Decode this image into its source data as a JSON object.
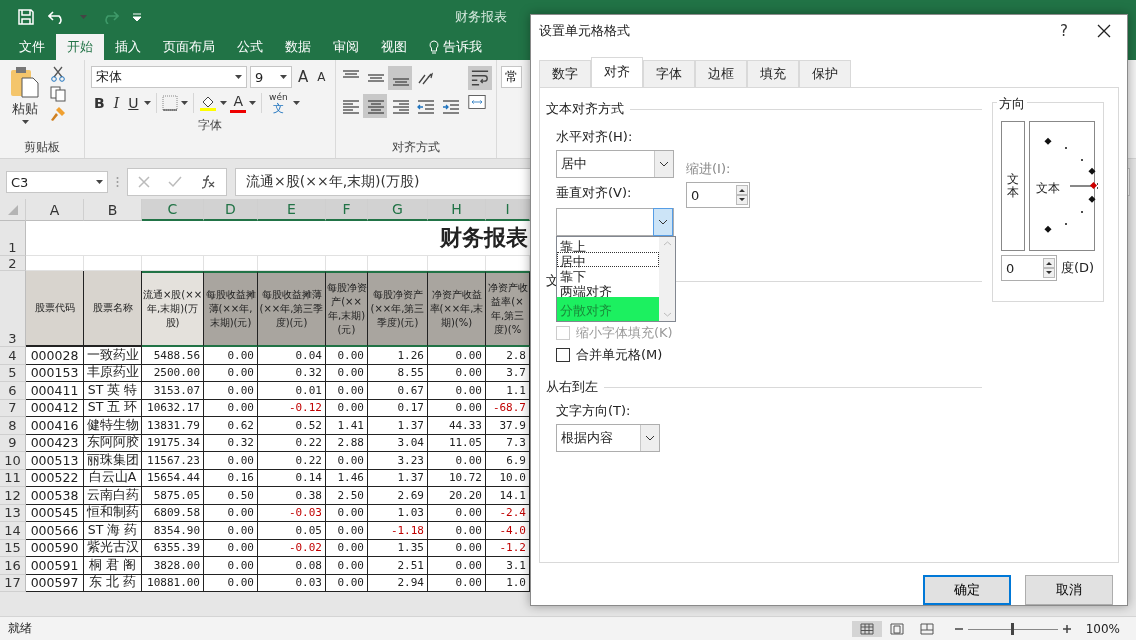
{
  "title_bar": {
    "title": "财务报表"
  },
  "ribbon_tabs": [
    {
      "label": "文件",
      "selected": false,
      "kind": "tab"
    },
    {
      "label": "开始",
      "selected": true,
      "kind": "tab"
    },
    {
      "label": "插入",
      "selected": false,
      "kind": "tab"
    },
    {
      "label": "页面布局",
      "selected": false,
      "kind": "tab"
    },
    {
      "label": "公式",
      "selected": false,
      "kind": "tab"
    },
    {
      "label": "数据",
      "selected": false,
      "kind": "tab"
    },
    {
      "label": "审阅",
      "selected": false,
      "kind": "tab"
    },
    {
      "label": "视图",
      "selected": false,
      "kind": "tab"
    },
    {
      "label": "告诉我",
      "selected": false,
      "kind": "tell"
    }
  ],
  "ribbon": {
    "clipboard": {
      "label": "剪贴板",
      "paste": "粘贴"
    },
    "font": {
      "label": "字体",
      "font_name": "宋体",
      "font_size": "9",
      "grow": "A",
      "shrink": "A",
      "bold": "B",
      "italic": "I",
      "underline": "U",
      "font_color": "A",
      "phonetic": "wén",
      "phonetic_char": "文"
    },
    "alignment": {
      "label": "对齐方式",
      "rows": [
        [
          {
            "kind": "top",
            "selected": false
          },
          {
            "kind": "middle",
            "selected": false
          },
          {
            "kind": "bottom",
            "selected": true
          },
          {
            "kind": "orient",
            "selected": false
          }
        ],
        [
          {
            "kind": "left",
            "selected": false
          },
          {
            "kind": "center",
            "selected": true
          },
          {
            "kind": "right",
            "selected": false
          },
          {
            "kind": "outdent",
            "selected": false
          },
          {
            "kind": "indent",
            "selected": false
          }
        ]
      ],
      "wrap_selected": true
    },
    "number": {
      "format": "常"
    }
  },
  "formula_bar": {
    "name_box": "C3",
    "formula": "流通×股(××年,末期)(万股)"
  },
  "sheet": {
    "columns": [
      {
        "label": "A",
        "selected": false
      },
      {
        "label": "B",
        "selected": false
      },
      {
        "label": "C",
        "selected": true
      },
      {
        "label": "D",
        "selected": true
      },
      {
        "label": "E",
        "selected": true
      },
      {
        "label": "F",
        "selected": true
      },
      {
        "label": "G",
        "selected": true
      },
      {
        "label": "H",
        "selected": true
      },
      {
        "label": "I",
        "selected": true
      }
    ],
    "title_row": "1",
    "blank_row": "2",
    "header_row_num": "3",
    "title": "财务报表",
    "header_row": [
      {
        "text": "股票代码",
        "selected": false,
        "active": false
      },
      {
        "text": "股票名称",
        "selected": false,
        "active": false
      },
      {
        "text": "流通×股(××年,末期)(万股)",
        "selected": true,
        "active": true
      },
      {
        "text": "每股收益摊薄(××年,末期)(元)",
        "selected": true,
        "active": false
      },
      {
        "text": "每股收益摊薄(××年,第三季度)(元)",
        "selected": true,
        "active": false
      },
      {
        "text": "每股净资产(××年,末期)(元)",
        "selected": true,
        "active": false
      },
      {
        "text": "每股净资产(××年,第三季度)(元)",
        "selected": true,
        "active": false
      },
      {
        "text": "净资产收益率(××年,末期)(%)",
        "selected": true,
        "active": false
      },
      {
        "text": "净资产收益率(×年,第三度)(%",
        "selected": true,
        "active": false
      }
    ],
    "rows": [
      {
        "num": "4",
        "cells": [
          "000028",
          "一致药业",
          "5488.56",
          "0.00",
          "0.04",
          "0.00",
          "1.26",
          "0.00",
          "2.8"
        ],
        "negative": [
          false,
          false,
          false,
          false,
          false,
          false,
          false,
          false,
          false
        ]
      },
      {
        "num": "5",
        "cells": [
          "000153",
          "丰原药业",
          "2500.00",
          "0.00",
          "0.32",
          "0.00",
          "8.55",
          "0.00",
          "3.7"
        ],
        "negative": [
          false,
          false,
          false,
          false,
          false,
          false,
          false,
          false,
          false
        ]
      },
      {
        "num": "6",
        "cells": [
          "000411",
          "ST 英 特",
          "3153.07",
          "0.00",
          "0.01",
          "0.00",
          "0.67",
          "0.00",
          "1.1"
        ],
        "negative": [
          false,
          false,
          false,
          false,
          false,
          false,
          false,
          false,
          false
        ]
      },
      {
        "num": "7",
        "cells": [
          "000412",
          "ST 五 环",
          "10632.17",
          "0.00",
          "-0.12",
          "0.00",
          "0.17",
          "0.00",
          "-68.7"
        ],
        "negative": [
          false,
          false,
          false,
          false,
          true,
          false,
          false,
          false,
          true
        ]
      },
      {
        "num": "8",
        "cells": [
          "000416",
          "健特生物",
          "13831.79",
          "0.62",
          "0.52",
          "1.41",
          "1.37",
          "44.33",
          "37.9"
        ],
        "negative": [
          false,
          false,
          false,
          false,
          false,
          false,
          false,
          false,
          false
        ]
      },
      {
        "num": "9",
        "cells": [
          "000423",
          "东阿阿胶",
          "19175.34",
          "0.32",
          "0.22",
          "2.88",
          "3.04",
          "11.05",
          "7.3"
        ],
        "negative": [
          false,
          false,
          false,
          false,
          false,
          false,
          false,
          false,
          false
        ]
      },
      {
        "num": "10",
        "cells": [
          "000513",
          "丽珠集团",
          "11567.23",
          "0.00",
          "0.22",
          "0.00",
          "3.23",
          "0.00",
          "6.9"
        ],
        "negative": [
          false,
          false,
          false,
          false,
          false,
          false,
          false,
          false,
          false
        ]
      },
      {
        "num": "11",
        "cells": [
          "000522",
          "白云山A",
          "15654.44",
          "0.16",
          "0.14",
          "1.46",
          "1.37",
          "10.72",
          "10.0"
        ],
        "negative": [
          false,
          false,
          false,
          false,
          false,
          false,
          false,
          false,
          false
        ]
      },
      {
        "num": "12",
        "cells": [
          "000538",
          "云南白药",
          "5875.05",
          "0.50",
          "0.38",
          "2.50",
          "2.69",
          "20.20",
          "14.1"
        ],
        "negative": [
          false,
          false,
          false,
          false,
          false,
          false,
          false,
          false,
          false
        ]
      },
      {
        "num": "13",
        "cells": [
          "000545",
          "恒和制药",
          "6809.58",
          "0.00",
          "-0.03",
          "0.00",
          "1.03",
          "0.00",
          "-2.4"
        ],
        "negative": [
          false,
          false,
          false,
          false,
          true,
          false,
          false,
          false,
          true
        ]
      },
      {
        "num": "14",
        "cells": [
          "000566",
          "ST 海 药",
          "8354.90",
          "0.00",
          "0.05",
          "0.00",
          "-1.18",
          "0.00",
          "-4.0"
        ],
        "negative": [
          false,
          false,
          false,
          false,
          false,
          false,
          true,
          false,
          true
        ]
      },
      {
        "num": "15",
        "cells": [
          "000590",
          "紫光古汉",
          "6355.39",
          "0.00",
          "-0.02",
          "0.00",
          "1.35",
          "0.00",
          "-1.2"
        ],
        "negative": [
          false,
          false,
          false,
          false,
          true,
          false,
          false,
          false,
          true
        ]
      },
      {
        "num": "16",
        "cells": [
          "000591",
          "桐 君 阁",
          "3828.00",
          "0.00",
          "0.08",
          "0.00",
          "2.51",
          "0.00",
          "3.1"
        ],
        "negative": [
          false,
          false,
          false,
          false,
          false,
          false,
          false,
          false,
          false
        ]
      },
      {
        "num": "17",
        "cells": [
          "000597",
          "东 北 药",
          "10881.00",
          "0.00",
          "0.03",
          "0.00",
          "2.94",
          "0.00",
          "1.0"
        ],
        "negative": [
          false,
          false,
          false,
          false,
          false,
          false,
          false,
          false,
          false
        ]
      }
    ]
  },
  "status_bar": {
    "status": "就绪",
    "zoom": "100%",
    "zoom_slider": {
      "level": 0.5
    },
    "views": [
      {
        "kind": "normal",
        "selected": true
      },
      {
        "kind": "page",
        "selected": false
      },
      {
        "kind": "break",
        "selected": false
      }
    ]
  },
  "dialog": {
    "title": "设置单元格格式",
    "help": "?",
    "tabs": [
      {
        "label": "数字",
        "selected": false
      },
      {
        "label": "对齐",
        "selected": true
      },
      {
        "label": "字体",
        "selected": false
      },
      {
        "label": "边框",
        "selected": false
      },
      {
        "label": "填充",
        "selected": false
      },
      {
        "label": "保护",
        "selected": false
      }
    ],
    "text_alignment": {
      "legend": "文本对齐方式",
      "horizontal_label": "水平对齐(H):",
      "horizontal_value": "居中",
      "indent_label": "缩进(I):",
      "indent_value": "0",
      "vertical_label": "垂直对齐(V):",
      "vertical_options": [
        {
          "label": "靠上",
          "selected": false,
          "focused": false
        },
        {
          "label": "居中",
          "selected": false,
          "focused": true
        },
        {
          "label": "靠下",
          "selected": false,
          "focused": false
        },
        {
          "label": "两端对齐",
          "selected": false,
          "focused": false
        },
        {
          "label": "分散对齐",
          "selected": true,
          "focused": false
        }
      ]
    },
    "text_control": {
      "legend": "文",
      "options": [
        {
          "label": "缩小字体填充(K)",
          "checked": false,
          "disabled": true
        },
        {
          "label": "合并单元格(M)",
          "checked": false,
          "disabled": false
        }
      ]
    },
    "rtl": {
      "legend": "从右到左",
      "direction_label": "文字方向(T):",
      "direction_value": "根据内容"
    },
    "orientation": {
      "legend": "方向",
      "vertical_text": "文本",
      "dial_text": "文本",
      "degrees_value": "0",
      "degrees_label": "度(D)"
    },
    "buttons": [
      {
        "label": "确定",
        "default": true
      },
      {
        "label": "取消",
        "default": false
      }
    ]
  }
}
